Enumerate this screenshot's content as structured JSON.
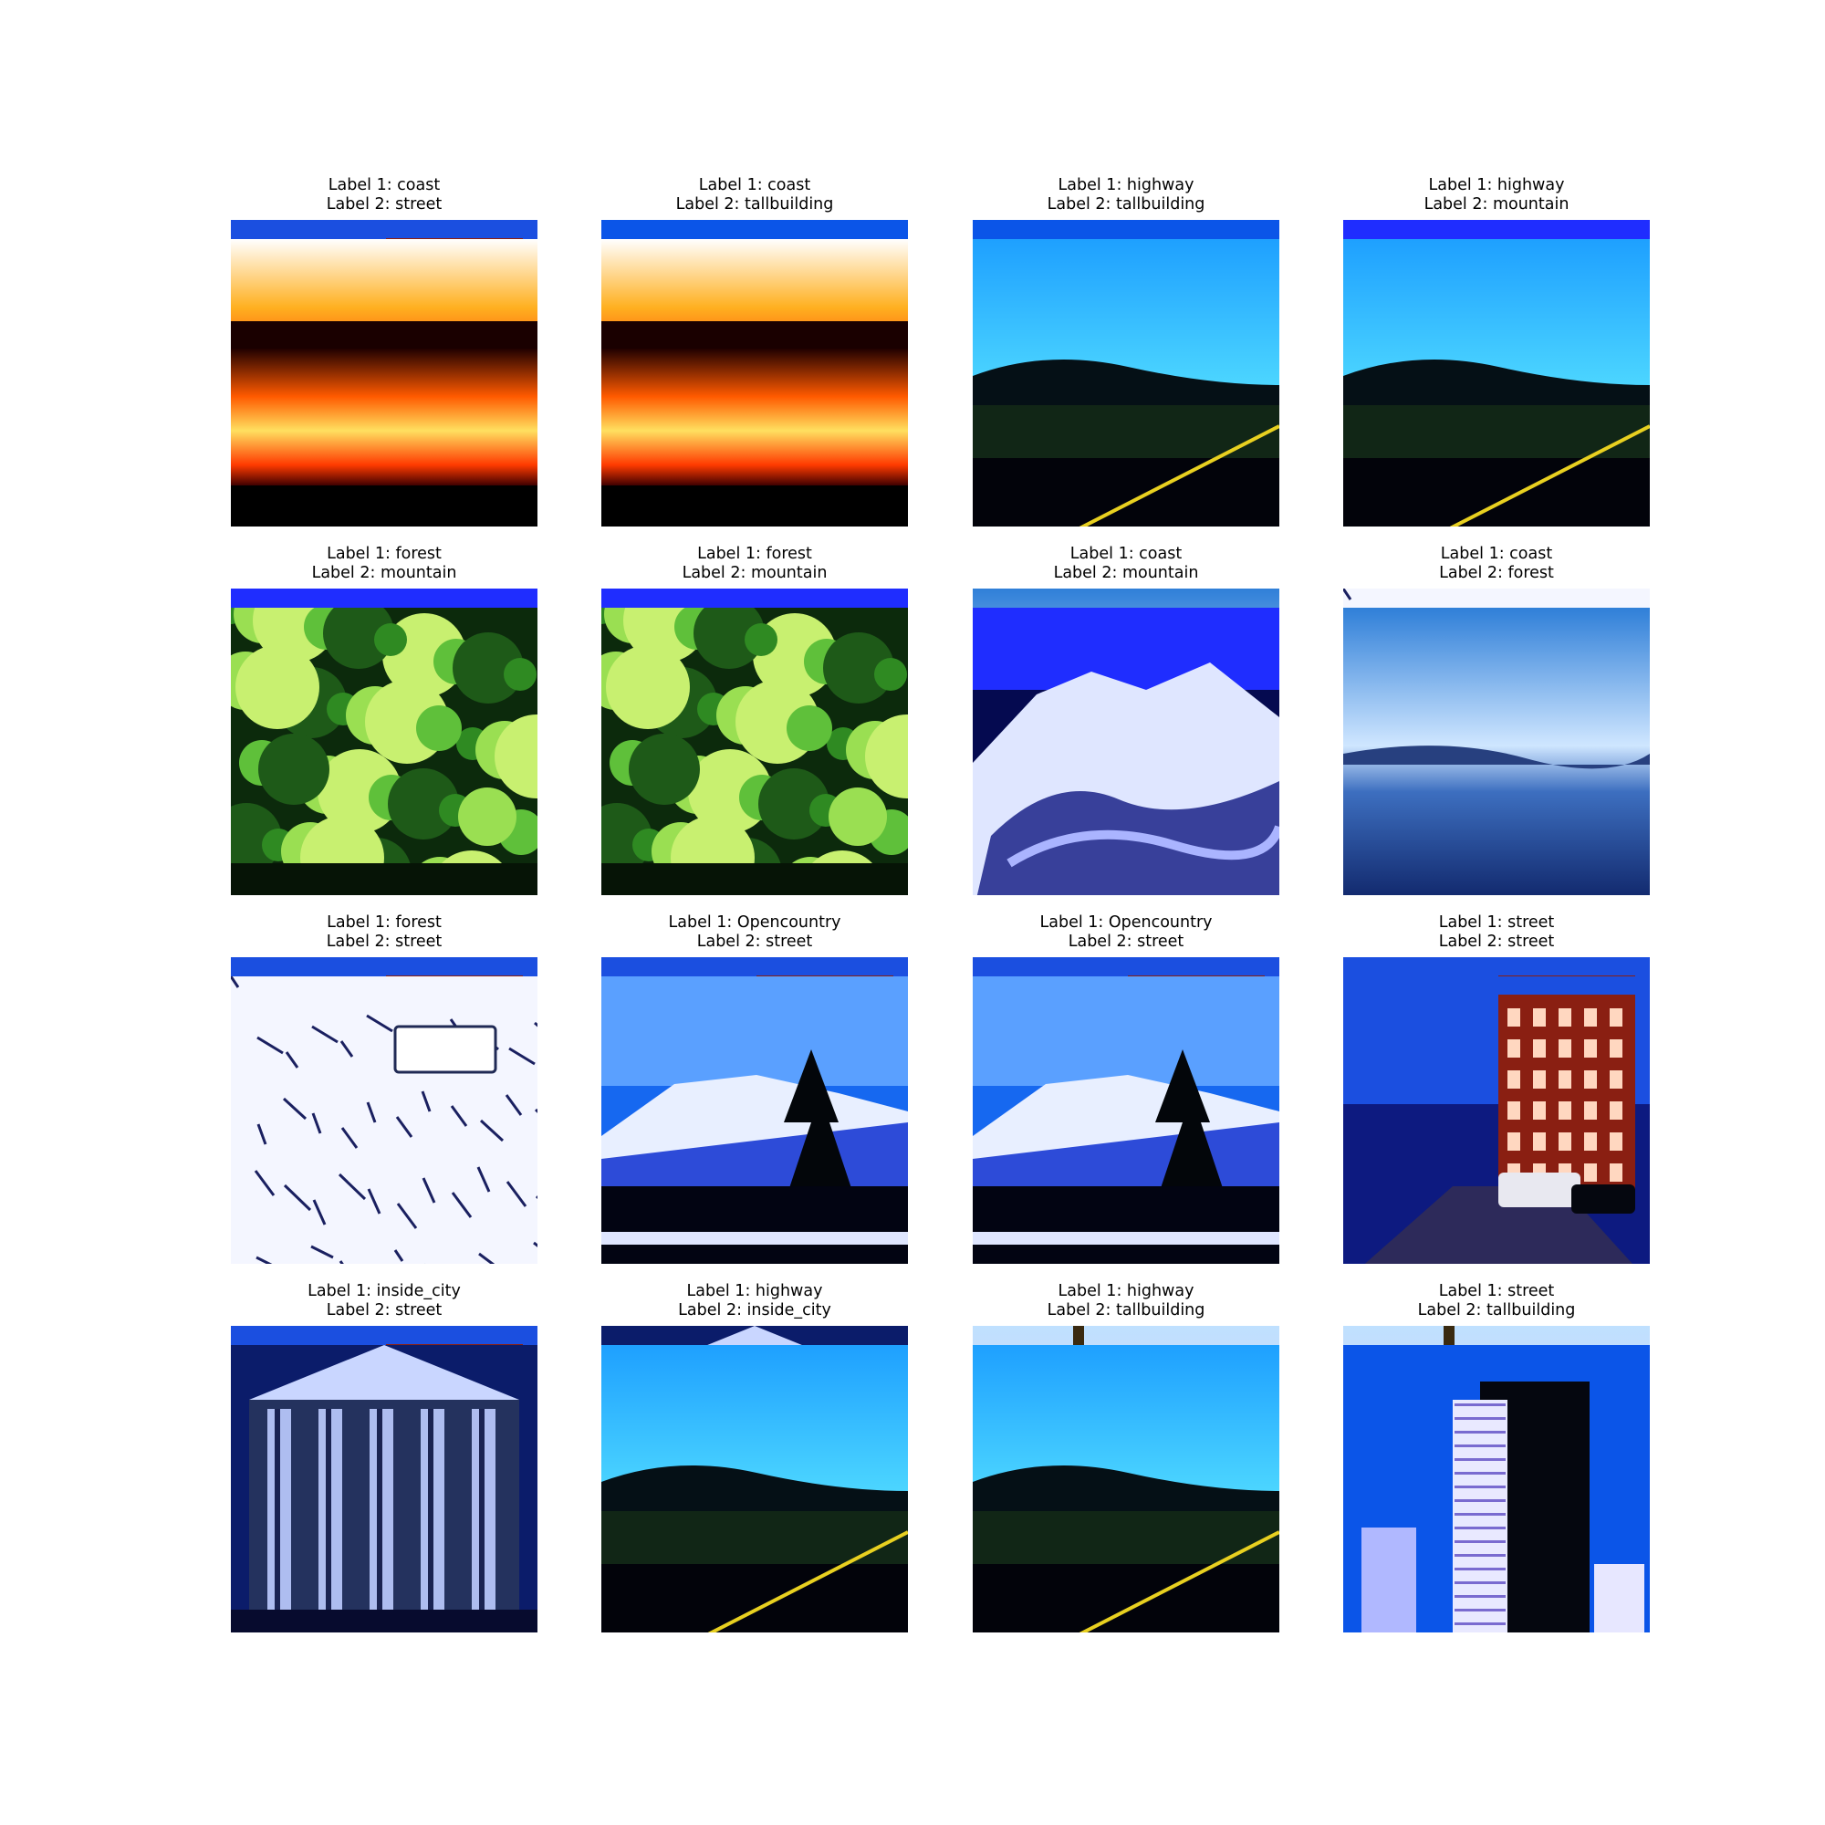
{
  "figure": {
    "panels": [
      {
        "label1": "Label 1: coast",
        "label2": "Label 2: street",
        "scene1": "coast",
        "scene2": "street"
      },
      {
        "label1": "Label 1: coast",
        "label2": "Label 2: tallbuilding",
        "scene1": "coast",
        "scene2": "tallbuilding"
      },
      {
        "label1": "Label 1: highway",
        "label2": "Label 2: tallbuilding",
        "scene1": "highway",
        "scene2": "tallbuilding"
      },
      {
        "label1": "Label 1: highway",
        "label2": "Label 2: mountain",
        "scene1": "highway",
        "scene2": "mountain"
      },
      {
        "label1": "Label 1: forest",
        "label2": "Label 2: mountain",
        "scene1": "forest",
        "scene2": "mountain"
      },
      {
        "label1": "Label 1: forest",
        "label2": "Label 2: mountain",
        "scene1": "forest",
        "scene2": "mountain"
      },
      {
        "label1": "Label 1: coast",
        "label2": "Label 2: mountain",
        "scene1": "coast",
        "scene2": "mountain"
      },
      {
        "label1": "Label 1: coast",
        "label2": "Label 2: forest",
        "scene1": "coast",
        "scene2": "forest"
      },
      {
        "label1": "Label 1: forest",
        "label2": "Label 2: street",
        "scene1": "forest",
        "scene2": "street"
      },
      {
        "label1": "Label 1: Opencountry",
        "label2": "Label 2: street",
        "scene1": "opencountry",
        "scene2": "street"
      },
      {
        "label1": "Label 1: Opencountry",
        "label2": "Label 2: street",
        "scene1": "opencountry",
        "scene2": "street"
      },
      {
        "label1": "Label 1: street",
        "label2": "Label 2: street",
        "scene1": "street",
        "scene2": "street"
      },
      {
        "label1": "Label 1: inside_city",
        "label2": "Label 2: street",
        "scene1": "inside_city",
        "scene2": "street"
      },
      {
        "label1": "Label 1: highway",
        "label2": "Label 2: inside_city",
        "scene1": "highway",
        "scene2": "inside_city"
      },
      {
        "label1": "Label 1: highway",
        "label2": "Label 2: tallbuilding",
        "scene1": "highway",
        "scene2": "tallbuilding"
      },
      {
        "label1": "Label 1: street",
        "label2": "Label 2: tallbuilding",
        "scene1": "street",
        "scene2": "tallbuilding"
      }
    ]
  }
}
